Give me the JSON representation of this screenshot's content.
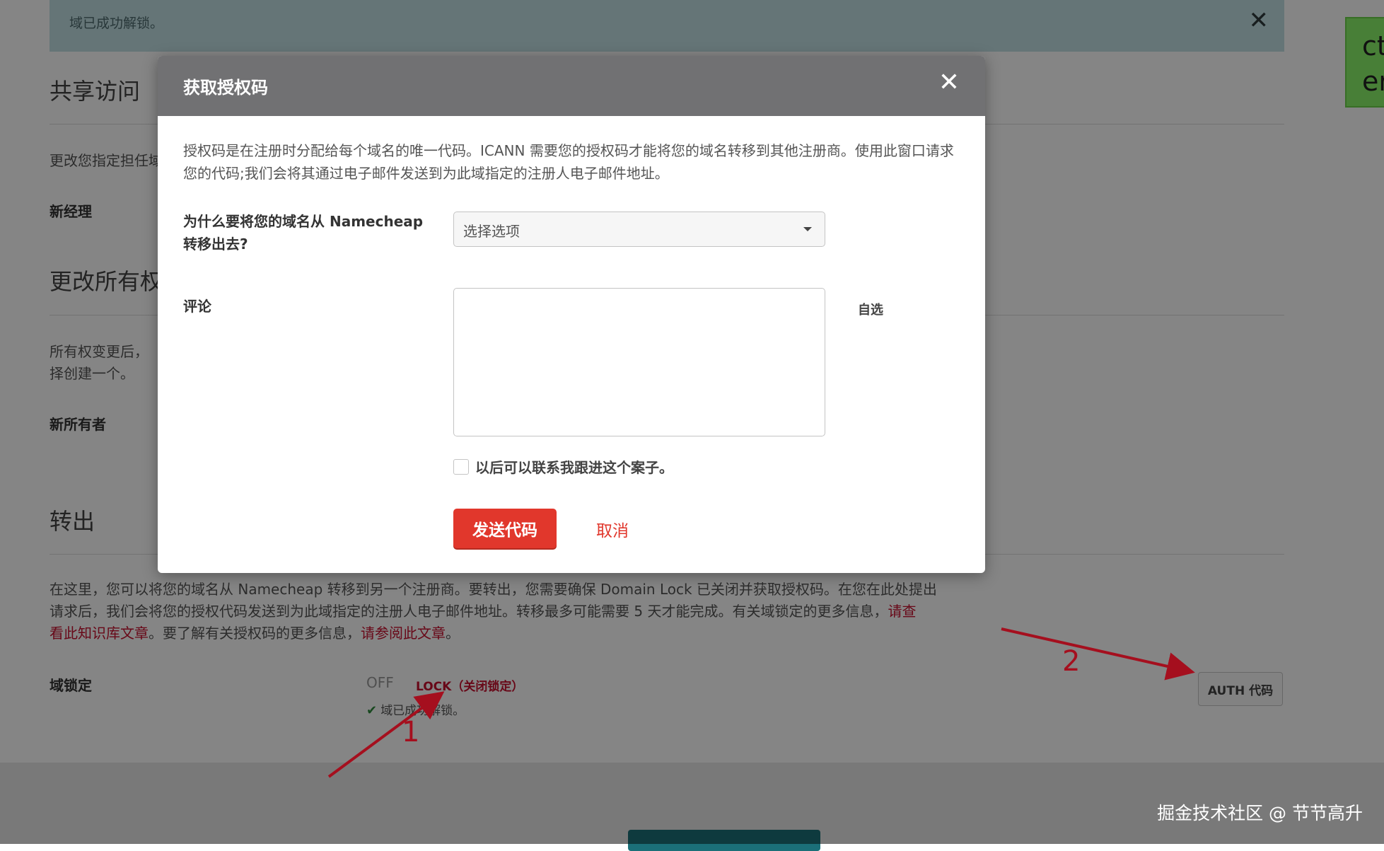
{
  "alert": {
    "message": "域已成功解锁。",
    "close": "✕"
  },
  "shared_access": {
    "title": "共享访问",
    "description": "更改您指定担任域",
    "new_manager_label": "新经理"
  },
  "ownership": {
    "title": "更改所有权",
    "description_line1": "所有权变更后，",
    "description_line2": "择创建一个。",
    "new_owner_label": "新所有者"
  },
  "transfer": {
    "title": "转出",
    "description_line1": "在这里，您可以将您的域名从 Namecheap 转移到另一个注册商。要转出，您需要确保 Domain Lock 已关闭并获取授权码。在您在此处提出",
    "description_line2": "请求后，我们会将您的授权代码发送到为此域指定的注册人电子邮件地址。转移最多可能需要 5 天才能完成。有关域锁定的更多信息，",
    "link_kb_part1": "请查",
    "link_kb_part2": "看此知识库文章",
    "description_line3_mid": "。要了解有关授权码的更多信息，",
    "link_auth": "请参阅此文章",
    "period": "。",
    "domain_lock_label": "域锁定",
    "lock_off": "OFF",
    "lock_on": "LOCK（关闭锁定）",
    "lock_status": "域已成功解锁。",
    "check_icon": "✔",
    "auth_button": "AUTH 代码"
  },
  "annotations": {
    "one": "1",
    "two": "2",
    "color": "#a50f1e"
  },
  "side_note": {
    "line1": "ct",
    "line2": "er"
  },
  "watermark": "掘金技术社区 @ 节节高升",
  "modal": {
    "title": "获取授权码",
    "close": "✕",
    "description": "授权码是在注册时分配给每个域名的唯一代码。ICANN 需要您的授权码才能将您的域名转移到其他注册商。使用此窗口请求您的代码;我们会将其通过电子邮件发送到为此域指定的注册人电子邮件地址。",
    "reason_label_line1": "为什么要将您的域名从 Namecheap",
    "reason_label_line2": "转移出去?",
    "reason_selected": "选择选项",
    "comment_label": "评论",
    "comment_value": "",
    "optional": "自选",
    "checkbox_label": "以后可以联系我跟进这个案子。",
    "send_button": "发送代码",
    "cancel_link": "取消"
  },
  "colors": {
    "primary": "#e1372c",
    "header": "#717173",
    "alert_bg": "#c2e1e5",
    "link": "#c8102e"
  }
}
